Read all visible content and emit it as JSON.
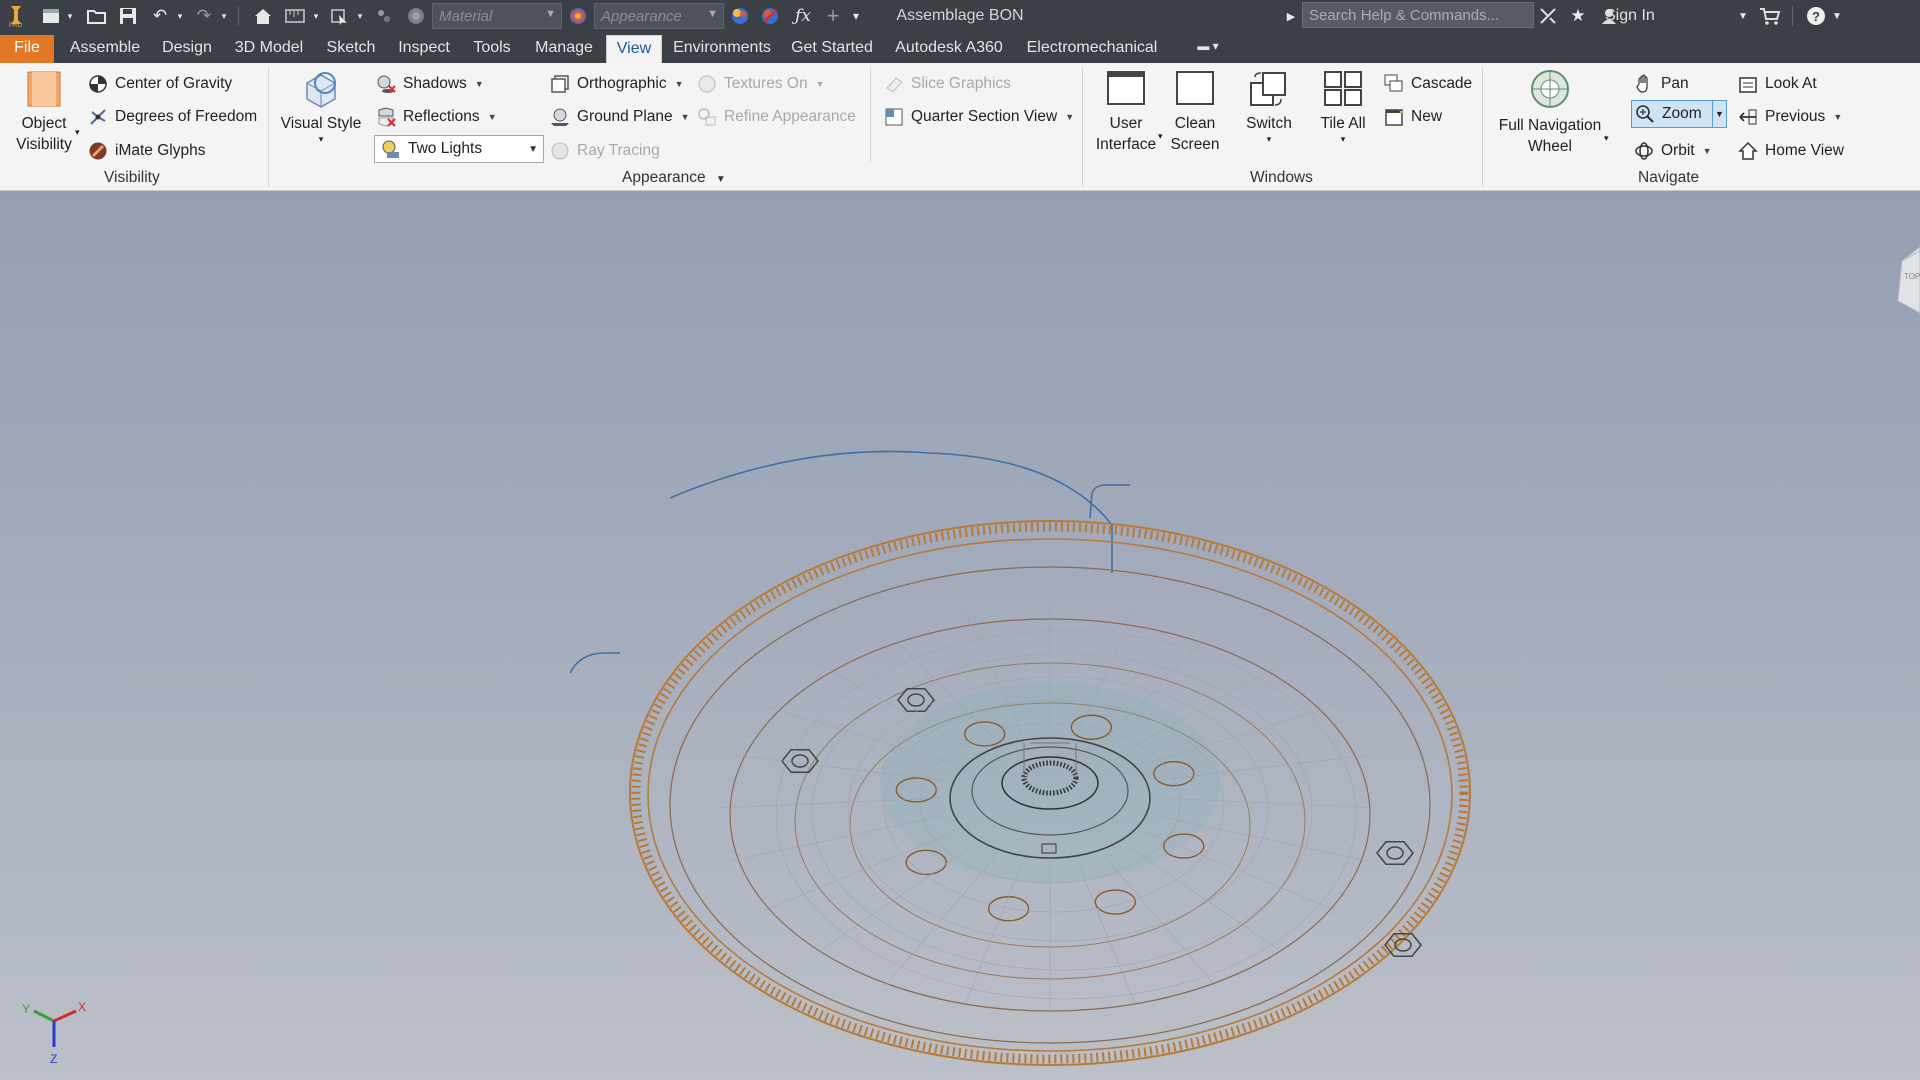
{
  "titlebar": {
    "material_placeholder": "Material",
    "appearance_placeholder": "Appearance",
    "document_title": "Assemblage BON",
    "search_placeholder": "Search Help & Commands...",
    "sign_in": "Sign In",
    "icons": [
      "app-logo-icon",
      "new-icon",
      "open-icon",
      "save-icon",
      "undo-icon",
      "redo-icon",
      "home-icon",
      "measure-icon",
      "select-icon",
      "color-icon",
      "material-icon",
      "appearance-icon",
      "clear-override-icon",
      "fx-icon",
      "plus-icon",
      "customize-icon",
      "exchange-icon",
      "star-icon",
      "user-icon",
      "cart-icon",
      "help-icon"
    ]
  },
  "tabs": [
    "File",
    "Assemble",
    "Design",
    "3D Model",
    "Sketch",
    "Inspect",
    "Tools",
    "Manage",
    "View",
    "Environments",
    "Get Started",
    "Autodesk A360",
    "Electromechanical"
  ],
  "active_tab": "View",
  "ribbon": {
    "visibility": {
      "object_visibility_1": "Object",
      "object_visibility_2": "Visibility",
      "center_of_gravity": "Center of Gravity",
      "degrees_of_freedom": "Degrees of Freedom",
      "imate_glyphs": "iMate Glyphs",
      "panel_label": "Visibility"
    },
    "appearance": {
      "visual_style": "Visual Style",
      "shadows": "Shadows",
      "reflections": "Reflections",
      "lighting_value": "Two Lights",
      "orthographic": "Orthographic",
      "ground_plane": "Ground Plane",
      "ray_tracing": "Ray Tracing",
      "textures_on": "Textures On",
      "refine_appearance": "Refine Appearance",
      "slice_graphics": "Slice Graphics",
      "quarter_section_view": "Quarter Section View",
      "panel_label": "Appearance"
    },
    "windows": {
      "user_interface_1": "User",
      "user_interface_2": "Interface",
      "clean_screen_1": "Clean",
      "clean_screen_2": "Screen",
      "switch": "Switch",
      "tile_all": "Tile All",
      "cascade": "Cascade",
      "new": "New",
      "panel_label": "Windows"
    },
    "navigate": {
      "full_nav_wheel_1": "Full Navigation",
      "full_nav_wheel_2": "Wheel",
      "pan": "Pan",
      "zoom": "Zoom",
      "orbit": "Orbit",
      "look_at": "Look At",
      "previous": "Previous",
      "home_view": "Home View",
      "panel_label": "Navigate"
    }
  },
  "viewport": {
    "model": "flywheel-wireframe",
    "viewcube_face": "TOP",
    "axis_labels": {
      "x": "X",
      "y": "Y",
      "z": "Z"
    },
    "colors": {
      "ring_gear": "#b87a3a",
      "edges": "#8a6a4c",
      "outline": "#3f6fa8",
      "hub": "#6fb0b0"
    }
  }
}
